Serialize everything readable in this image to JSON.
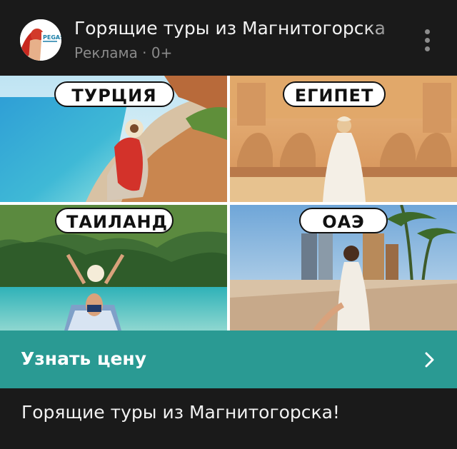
{
  "post": {
    "title": "Горящие туры из Магнитогорска",
    "subtitle": "Реклама · 0+",
    "avatar_logo": "PEGAS",
    "menu_icon": "more-vertical-icon"
  },
  "tiles": [
    {
      "label": "ТУРЦИЯ"
    },
    {
      "label": "ЕГИПЕТ"
    },
    {
      "label": "ТАИЛАНД"
    },
    {
      "label": "ОАЭ"
    }
  ],
  "cta": {
    "label": "Узнать цену",
    "icon": "chevron-right-icon",
    "color": "#2a9a93"
  },
  "caption": "Горящие туры из Магнитогорска!"
}
